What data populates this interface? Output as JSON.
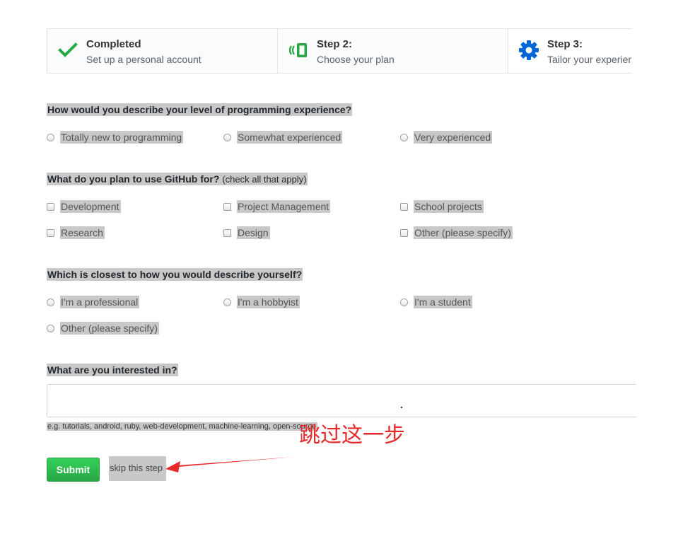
{
  "steps": [
    {
      "title": "Completed",
      "desc": "Set up a personal account"
    },
    {
      "title": "Step 2:",
      "desc": "Choose your plan"
    },
    {
      "title": "Step 3:",
      "desc": "Tailor your experier"
    }
  ],
  "q1": {
    "heading": "How would you describe your level of programming experience?",
    "options": [
      "Totally new to programming",
      "Somewhat experienced",
      "Very experienced"
    ]
  },
  "q2": {
    "heading": "What do you plan to use GitHub for?",
    "note": "(check all that apply)",
    "options": [
      "Development",
      "Project Management",
      "School projects",
      "Research",
      "Design",
      "Other (please specify)"
    ]
  },
  "q3": {
    "heading": "Which is closest to how you would describe yourself?",
    "options": [
      "I'm a professional",
      "I'm a hobbyist",
      "I'm a student",
      "Other (please specify)"
    ]
  },
  "q4": {
    "heading": "What are you interested in?",
    "value": "",
    "hint": "e.g. tutorials, android, ruby, web-development, machine-learning, open-source"
  },
  "actions": {
    "submit": "Submit",
    "skip": "skip this step"
  },
  "annotation": {
    "text": "跳过这一步",
    "color": "#e8282a"
  },
  "colors": {
    "accent_green": "#28a745",
    "accent_blue": "#0366d6",
    "highlight_gray": "#c8c8c8"
  }
}
